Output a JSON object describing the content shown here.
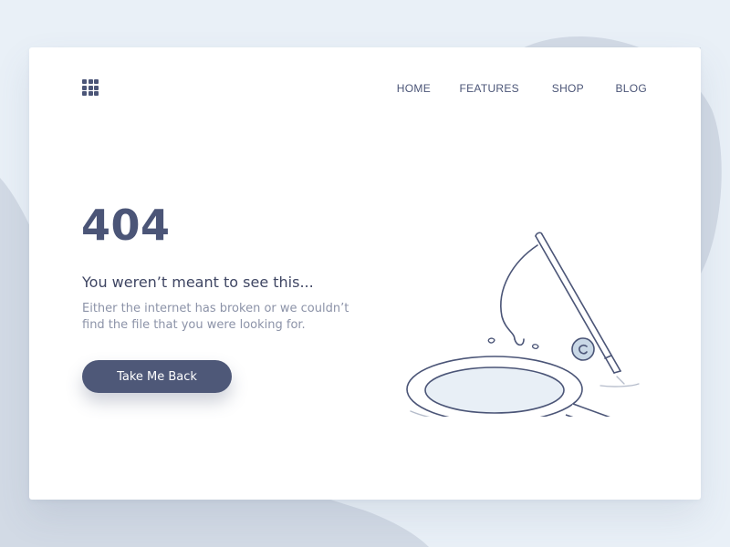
{
  "nav": {
    "items": [
      {
        "label": "HOME"
      },
      {
        "label": "FEATURES"
      },
      {
        "label": "SHOP"
      },
      {
        "label": "BLOG"
      }
    ]
  },
  "error": {
    "code": "404",
    "headline": "You weren’t meant to see this...",
    "description": "Either the internet has broken or we couldn’t find the file that you were looking for.",
    "button_label": "Take Me Back"
  },
  "icons": {
    "menu": "apps-grid-icon",
    "illustration": "fishing-rod-net-illustration"
  },
  "colors": {
    "background": "#e9f0f7",
    "background_shape": "#d2dae5",
    "card": "#ffffff",
    "primary_text": "#4b5577",
    "secondary_text": "#8c93a8",
    "button": "#4e5878",
    "illustration_fill": "#e8eff6"
  }
}
